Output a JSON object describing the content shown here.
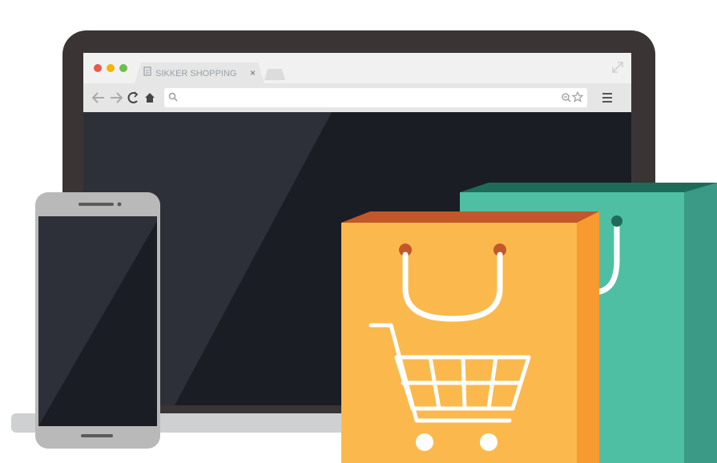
{
  "browser": {
    "tab_title": "SIKKER SHOPPING",
    "tab_close_glyph": "×",
    "window_controls": [
      "close-dot",
      "minimize-dot",
      "maximize-dot"
    ],
    "nav_icons": [
      "back-arrow-icon",
      "forward-arrow-icon",
      "reload-icon",
      "home-icon"
    ],
    "address_value": "",
    "menu_icon": "hamburger-menu-icon"
  },
  "colors": {
    "laptop_frame": "#3a3435",
    "screen": "#1b1d24",
    "browser_chrome": "#ececec",
    "dot_red": "#e85a4f",
    "dot_yellow": "#f4b400",
    "dot_green": "#6cc04a",
    "phone_body": "#b9b9b9",
    "bag_orange": "#fbb94d",
    "bag_orange_side": "#f79a2f",
    "bag_orange_top": "#c2572a",
    "bag_teal": "#4fbfa3",
    "bag_teal_side": "#3a9a85",
    "bag_teal_top": "#1f6b5a"
  }
}
